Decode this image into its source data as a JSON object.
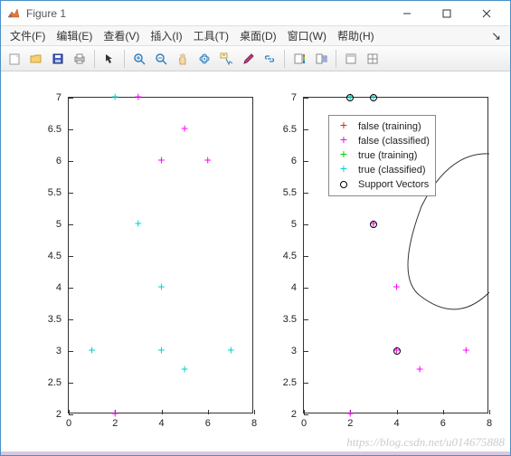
{
  "window": {
    "title": "Figure 1"
  },
  "menu": {
    "items": [
      "文件(F)",
      "编辑(E)",
      "查看(V)",
      "插入(I)",
      "工具(T)",
      "桌面(D)",
      "窗口(W)",
      "帮助(H)"
    ]
  },
  "toolbar_icons": [
    "new",
    "open",
    "save",
    "print",
    "arrow",
    "zoom-in",
    "zoom-out",
    "pan",
    "rotate",
    "datacursor",
    "brush",
    "link",
    "colorbar",
    "legend",
    "grid",
    "subplot",
    "dock"
  ],
  "legend": {
    "items": [
      {
        "label": "false (training)",
        "marker": "plus",
        "color": "#d62728"
      },
      {
        "label": "false (classified)",
        "marker": "plus",
        "color": "#ff00ff"
      },
      {
        "label": "true (training)",
        "marker": "plus",
        "color": "#00cc00"
      },
      {
        "label": "true (classified)",
        "marker": "plus",
        "color": "#00d0d0"
      },
      {
        "label": "Support Vectors",
        "marker": "circle",
        "color": "#000"
      }
    ]
  },
  "chart_data": [
    {
      "type": "scatter",
      "title": "",
      "xlim": [
        0,
        8
      ],
      "ylim": [
        2,
        7
      ],
      "xticks": [
        0,
        2,
        4,
        6,
        8
      ],
      "yticks": [
        2,
        2.5,
        3,
        3.5,
        4,
        4.5,
        5,
        5.5,
        6,
        6.5,
        7
      ],
      "series": [
        {
          "name": "false (training)",
          "marker": "plus",
          "color": "#d62728",
          "points": []
        },
        {
          "name": "false (classified)",
          "marker": "plus",
          "color": "#ff00ff",
          "points": [
            [
              3,
              7
            ],
            [
              5,
              6.5
            ],
            [
              4,
              6
            ],
            [
              6,
              6
            ],
            [
              2,
              2
            ]
          ]
        },
        {
          "name": "true (training)",
          "marker": "plus",
          "color": "#00cc00",
          "points": []
        },
        {
          "name": "true (classified)",
          "marker": "plus",
          "color": "#00d0d0",
          "points": [
            [
              2,
              7
            ],
            [
              3,
              5
            ],
            [
              4,
              4
            ],
            [
              1,
              3
            ],
            [
              4,
              3
            ],
            [
              7,
              3
            ],
            [
              5,
              2.7
            ]
          ]
        },
        {
          "name": "Support Vectors",
          "marker": "circle",
          "color": "#000",
          "points": []
        }
      ]
    },
    {
      "type": "scatter",
      "title": "",
      "xlim": [
        0,
        8
      ],
      "ylim": [
        2,
        7
      ],
      "xticks": [
        0,
        2,
        4,
        6,
        8
      ],
      "yticks": [
        2,
        2.5,
        3,
        3.5,
        4,
        4.5,
        5,
        5.5,
        6,
        6.5,
        7
      ],
      "series": [
        {
          "name": "false (training)",
          "marker": "plus",
          "color": "#d62728",
          "points": [
            [
              3,
              5
            ],
            [
              4,
              3
            ]
          ]
        },
        {
          "name": "false (classified)",
          "marker": "plus",
          "color": "#ff00ff",
          "points": [
            [
              3,
              5
            ],
            [
              4,
              4
            ],
            [
              4,
              3
            ],
            [
              7,
              3
            ],
            [
              5,
              2.7
            ],
            [
              2,
              2
            ]
          ]
        },
        {
          "name": "true (training)",
          "marker": "plus",
          "color": "#00cc00",
          "points": [
            [
              2,
              7
            ]
          ]
        },
        {
          "name": "true (classified)",
          "marker": "plus",
          "color": "#00d0d0",
          "points": [
            [
              2,
              7
            ],
            [
              3,
              7
            ]
          ]
        },
        {
          "name": "Support Vectors",
          "marker": "circle",
          "color": "#000",
          "points": [
            [
              2,
              7
            ],
            [
              3,
              7
            ],
            [
              3,
              5
            ],
            [
              4,
              3
            ]
          ]
        }
      ],
      "decision_boundary": true
    }
  ],
  "watermark": "https://blog.csdn.net/u014675888"
}
